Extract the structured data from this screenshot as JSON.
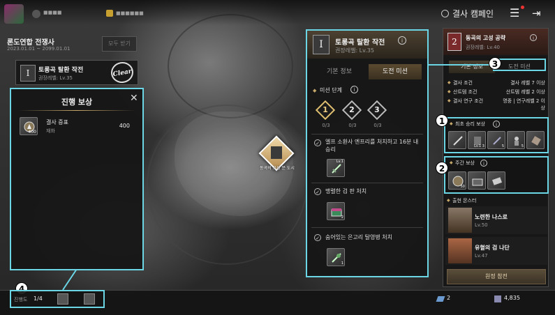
{
  "top": {
    "campaign_label": "결사 캠페인",
    "player_name": "■■■■",
    "player_extra": "■■■■■■"
  },
  "left": {
    "event_title": "론도연합 전쟁사",
    "event_dates": "2023.01.01 ~ 2099.01.01",
    "receive_all": "모두 받기",
    "mission": {
      "numeral": "I",
      "title": "토롱곡 탈환 작전",
      "level": "권장레벨: Lv.35",
      "stamp": "Clear"
    }
  },
  "progress_reward": {
    "title": "진행 보상",
    "items": [
      {
        "name": "결사 증표",
        "type": "재화",
        "count": "400",
        "badge": "400"
      }
    ]
  },
  "map_marker": {
    "label": "동곡의 고성 문 도시"
  },
  "bottom": {
    "progress_label": "진행도",
    "progress_value": "1/4",
    "currency1": "2",
    "currency2": "4,835"
  },
  "center": {
    "numeral": "I",
    "title": "토롱곡 탈환 작전",
    "level": "권장레벨: Lv.35",
    "tabs": [
      "기본 정보",
      "도전 미션"
    ],
    "mission_stage_label": "미션 단계",
    "stages": [
      {
        "num": "1",
        "progress": "0/3"
      },
      {
        "num": "2",
        "progress": "0/3"
      },
      {
        "num": "3",
        "progress": "0/3"
      }
    ],
    "missions": [
      {
        "text": "엘프 소환사 엔프리를 처치하고 16분 내 승리",
        "reward_badge": "Lv.1"
      },
      {
        "text": "맹렬한 검 판 처치",
        "reward_badge": "2"
      },
      {
        "text": "숨어있는 은고리 탈영병 처치",
        "reward_badge": "1"
      }
    ]
  },
  "right": {
    "numeral": "2",
    "title": "동곡의 고성 공략",
    "level": "권장레벨: Lv.40",
    "tabs": [
      "기본 정보",
      "도전 미션"
    ],
    "conditions": [
      {
        "label": "결사 조건",
        "value": "결사 레벨 7 이상"
      },
      {
        "label": "산트템 조건",
        "value": "산트템 레벨 2 이상"
      },
      {
        "label": "결사 연구 조건",
        "value": "명중 | 연구레벨 2 이상"
      }
    ],
    "first_win_label": "최초 승리 보상",
    "first_win_badges": [
      "",
      "Lv.1 3",
      "5",
      "5",
      ""
    ],
    "weekly_label": "주간 보상",
    "weekly_badges": [
      "50",
      "",
      ""
    ],
    "monsters_label": "출현 몬스터",
    "monsters": [
      {
        "name": "노련한 나스로",
        "level": "Lv.50"
      },
      {
        "name": "유혈의 검 나단",
        "level": "Lv.47"
      }
    ],
    "expedition_button": "원정 참전"
  },
  "annotations": [
    "1",
    "2",
    "3",
    "4"
  ],
  "colors": {
    "highlight": "#6ad6e6",
    "gold": "#c8a86a"
  }
}
